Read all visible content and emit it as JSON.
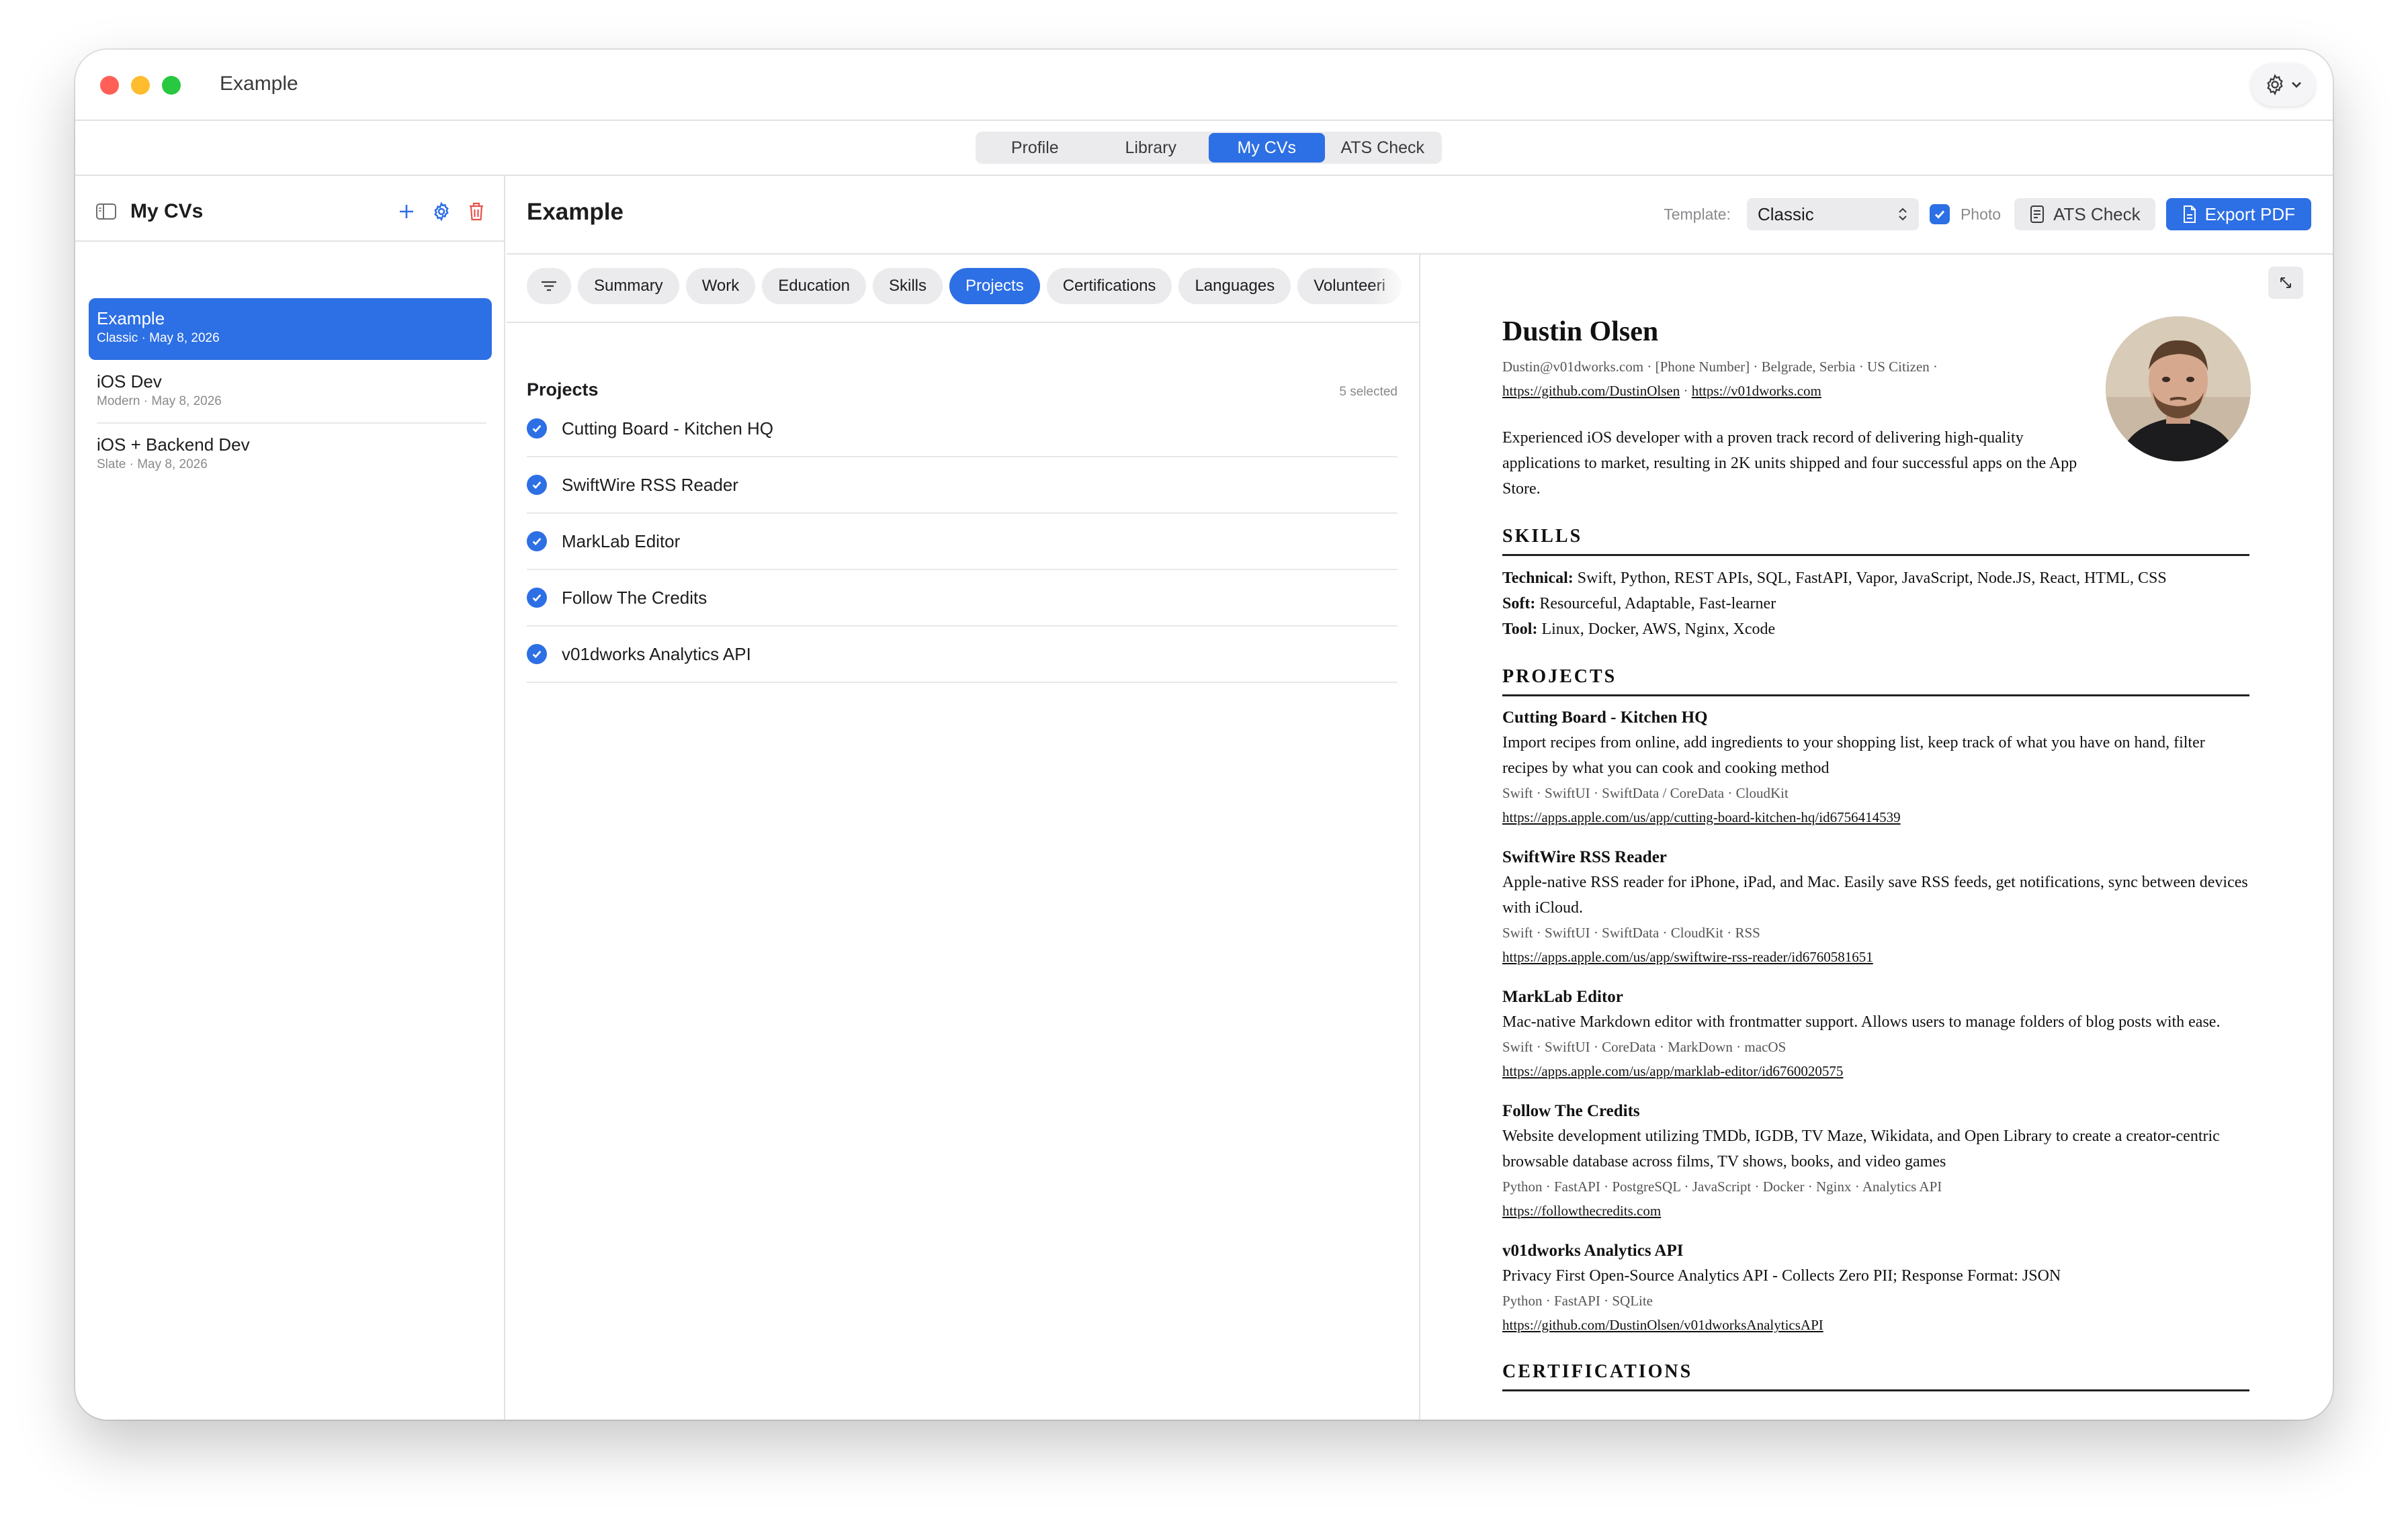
{
  "window": {
    "title": "Example"
  },
  "nav": {
    "tabs": [
      {
        "label": "Profile"
      },
      {
        "label": "Library"
      },
      {
        "label": "My CVs"
      },
      {
        "label": "ATS Check"
      }
    ],
    "active": "My CVs"
  },
  "sidebar": {
    "title": "My CVs",
    "items": [
      {
        "name": "Example",
        "template": "Classic",
        "date": "May 8, 2026",
        "separator": "·"
      },
      {
        "name": "iOS Dev",
        "template": "Modern",
        "date": "May 8, 2026",
        "separator": "·"
      },
      {
        "name": "iOS + Backend Dev",
        "template": "Slate",
        "date": "May 8, 2026",
        "separator": "·"
      }
    ]
  },
  "editor": {
    "title": "Example",
    "template_label": "Template:",
    "template_value": "Classic",
    "photo_label": "Photo",
    "ats_button": "ATS Check",
    "export_button": "Export PDF",
    "sections": [
      {
        "label": "Summary"
      },
      {
        "label": "Work"
      },
      {
        "label": "Education"
      },
      {
        "label": "Skills"
      },
      {
        "label": "Projects"
      },
      {
        "label": "Certifications"
      },
      {
        "label": "Languages"
      },
      {
        "label": "Volunteeri"
      }
    ],
    "active_section": "Projects",
    "list_title": "Projects",
    "selected_count": "5 selected",
    "projects": [
      {
        "name": "Cutting Board - Kitchen HQ"
      },
      {
        "name": "SwiftWire RSS Reader"
      },
      {
        "name": "MarkLab Editor"
      },
      {
        "name": "Follow The Credits"
      },
      {
        "name": "v01dworks Analytics API"
      }
    ]
  },
  "preview": {
    "name": "Dustin Olsen",
    "contact": "Dustin@v01dworks.com · [Phone Number] · Belgrade, Serbia · US Citizen ·",
    "link1": "https://github.com/DustinOlsen",
    "link_sep": "·",
    "link2": "https://v01dworks.com",
    "summary": "Experienced iOS developer with a proven track record of delivering high-quality applications to market, resulting in 2K units shipped and four successful apps on the App Store.",
    "skills_heading": "SKILLS",
    "skills": [
      {
        "label": "Technical:",
        "value": "Swift, Python, REST APIs, SQL, FastAPI, Vapor, JavaScript, Node.JS, React, HTML, CSS"
      },
      {
        "label": "Soft:",
        "value": "Resourceful, Adaptable, Fast-learner"
      },
      {
        "label": "Tool:",
        "value": "Linux, Docker, AWS, Nginx, Xcode"
      }
    ],
    "projects_heading": "PROJECTS",
    "projects": [
      {
        "title": "Cutting Board - Kitchen HQ",
        "desc": "Import recipes from online, add ingredients to your shopping list, keep track of what you have on hand, filter recipes by what you can cook and cooking method",
        "tech": "Swift · SwiftUI · SwiftData / CoreData · CloudKit",
        "link": "https://apps.apple.com/us/app/cutting-board-kitchen-hq/id6756414539"
      },
      {
        "title": "SwiftWire RSS Reader",
        "desc": "Apple-native RSS reader for iPhone, iPad, and Mac. Easily save RSS feeds, get notifications, sync between devices with iCloud.",
        "tech": "Swift · SwiftUI · SwiftData · CloudKit · RSS",
        "link": "https://apps.apple.com/us/app/swiftwire-rss-reader/id6760581651"
      },
      {
        "title": "MarkLab Editor",
        "desc": "Mac-native Markdown editor with frontmatter support. Allows users to manage folders of blog posts with ease.",
        "tech": "Swift · SwiftUI · CoreData · MarkDown · macOS",
        "link": "https://apps.apple.com/us/app/marklab-editor/id6760020575"
      },
      {
        "title": "Follow The Credits",
        "desc": "Website development utilizing TMDb, IGDB, TV Maze, Wikidata, and Open Library to create a creator-centric browsable database across films, TV shows, books, and video games",
        "tech": "Python · FastAPI · PostgreSQL · JavaScript · Docker · Nginx · Analytics API",
        "link": "https://followthecredits.com"
      },
      {
        "title": "v01dworks Analytics API",
        "desc": "Privacy First Open-Source Analytics API - Collects Zero PII; Response Format: JSON",
        "tech": "Python · FastAPI · SQLite",
        "link": "https://github.com/DustinOlsen/v01dworksAnalyticsAPI"
      }
    ],
    "next_heading": "CERTIFICATIONS"
  },
  "colors": {
    "accent": "#2d6fe4",
    "delete": "#e5534b"
  },
  "icons": [
    "sidebar-toggle-icon",
    "plus-icon",
    "gear-icon",
    "trash-icon",
    "filter-icon",
    "checkmark-icon",
    "chevron-updown-icon",
    "document-icon",
    "expand-icon",
    "chevron-down-icon"
  ]
}
